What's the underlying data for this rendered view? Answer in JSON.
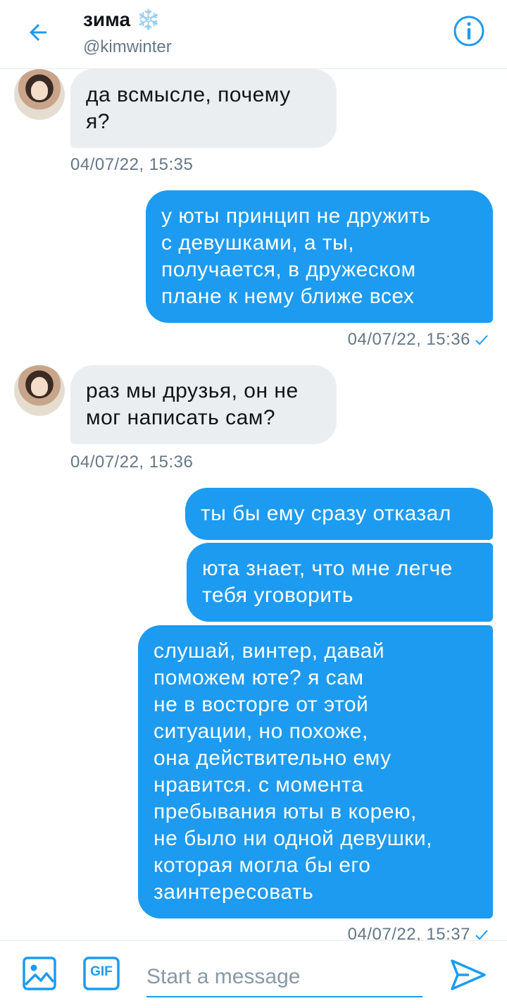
{
  "header": {
    "title": "зима",
    "emoji": "❄️",
    "handle": "@kimwinter"
  },
  "messages": [
    {
      "dir": "in",
      "text_lines": [
        "да всмысле, почему",
        "я?"
      ],
      "time": "04/07/22, 15:35"
    },
    {
      "dir": "out",
      "text_lines": [
        "у юты принцип не дружить",
        "с девушками, а ты,",
        "получается, в дружеском",
        "плане к нему ближе всех"
      ],
      "time": "04/07/22, 15:36",
      "read": true
    },
    {
      "dir": "in",
      "text_lines": [
        "раз мы друзья, он не",
        "мог написать сам?"
      ],
      "time": "04/07/22, 15:36"
    },
    {
      "dir": "out",
      "text_lines": [
        "ты бы ему сразу отказал"
      ]
    },
    {
      "dir": "out",
      "text_lines": [
        "юта знает, что мне легче",
        "тебя уговорить"
      ]
    },
    {
      "dir": "out",
      "text_lines": [
        "слушай, винтер, давай",
        "поможем юте? я сам",
        "не в восторге от этой",
        "ситуации, но похоже,",
        "она действительно ему",
        "нравится. с момента",
        "пребывания юты в корею,",
        "не было ни одной девушки,",
        "которая могла бы его",
        "заинтересовать"
      ],
      "time": "04/07/22, 15:37",
      "read": true
    }
  ],
  "composer": {
    "placeholder": "Start a message",
    "gif_label": "GIF"
  },
  "colors": {
    "accent": "#1d9bf0",
    "incoming_bubble": "#ebeef0",
    "muted_text": "#657786"
  },
  "icons": [
    "back-arrow-icon",
    "info-icon",
    "image-icon",
    "gif-icon",
    "send-icon",
    "checkmark-icon",
    "snowflake-icon"
  ]
}
